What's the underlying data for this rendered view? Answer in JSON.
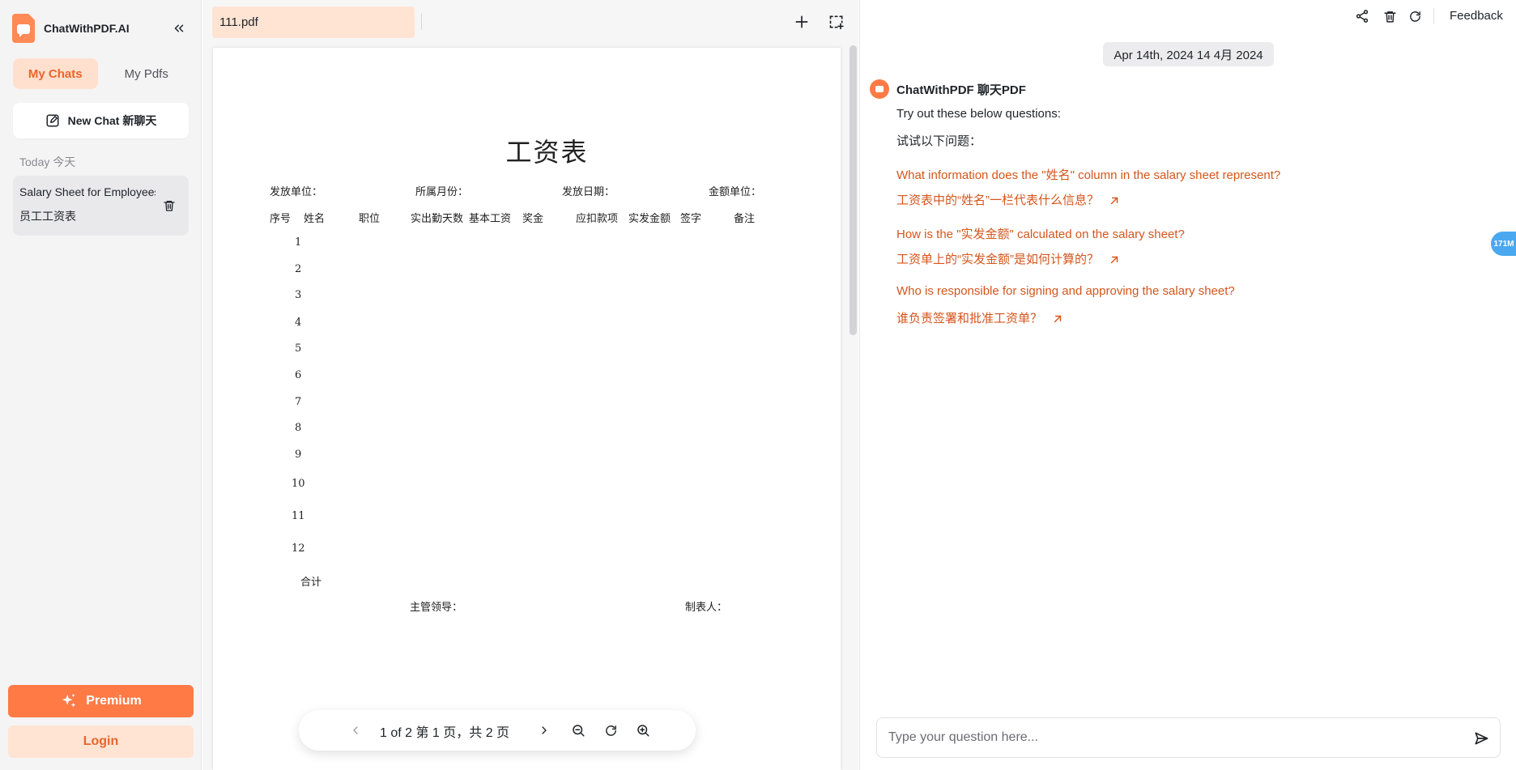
{
  "brand": {
    "name": "ChatWithPDF.AI"
  },
  "sidebar": {
    "tabs": [
      {
        "label": "My Chats"
      },
      {
        "label": "My Pdfs"
      }
    ],
    "new_chat_label": "New Chat 新聊天",
    "section_label": "Today 今天",
    "chat_item": {
      "title": "Salary Sheet for Employees",
      "subtitle": "员工工资表"
    },
    "premium_label": "Premium",
    "login_label": "Login"
  },
  "pdf": {
    "file_name": "111.pdf",
    "title": "工资表",
    "header_fields": [
      "发放单位：",
      "所属月份：",
      "发放日期：",
      "金额单位："
    ],
    "columns": [
      "序号",
      "姓名",
      "职位",
      "实出勤天数",
      "基本工资",
      "奖金",
      "应扣款项",
      "实发金额",
      "签字",
      "备注"
    ],
    "rows": [
      "1",
      "2",
      "3",
      "4",
      "5",
      "6",
      "7",
      "8",
      "9",
      "10",
      "11",
      "12"
    ],
    "total_label": "合计",
    "footer": [
      "主管领导：",
      "制表人："
    ],
    "pager": "1 of 2 第 1 页，共 2 页"
  },
  "chat": {
    "feedback_label": "Feedback",
    "date": "Apr 14th, 2024 14 4月 2024",
    "bot_name": "ChatWithPDF 聊天PDF",
    "intro_en": "Try out these below questions:",
    "intro_zh": "试试以下问题：",
    "suggestions": [
      {
        "en": "What information does the \"姓名\" column in the salary sheet represent?",
        "zh": "工资表中的“姓名”一栏代表什么信息？"
      },
      {
        "en": "How is the \"实发金额\" calculated on the salary sheet?",
        "zh": "工资单上的“实发金额”是如何计算的？"
      },
      {
        "en": "Who is responsible for signing and approving the salary sheet?",
        "zh": "谁负责签署和批准工资单？"
      }
    ],
    "input_placeholder": "Type your question here...",
    "side_badge": "171M"
  },
  "colors": {
    "accent": "#ff7a45",
    "accent_soft": "#ffe3d3",
    "link": "#d4561c"
  }
}
